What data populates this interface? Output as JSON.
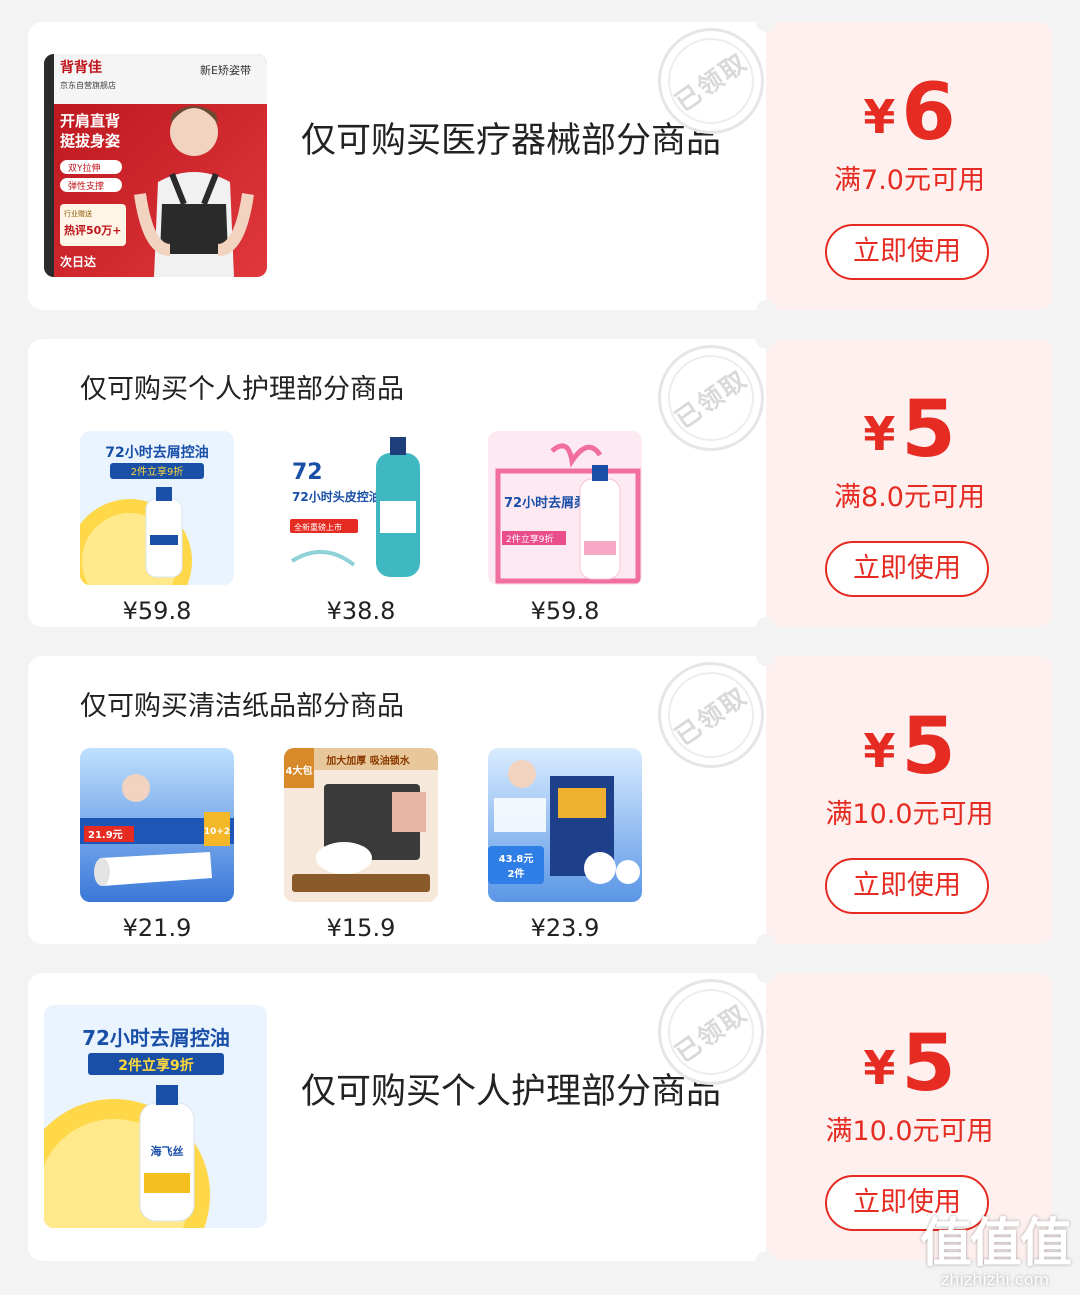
{
  "stamp_text": "已领取",
  "use_label": "立即使用",
  "currency": "¥",
  "coupons": [
    {
      "amount": "6",
      "condition": "满7.0元可用",
      "description": "仅可购买医疗器械部分商品",
      "thumb": {
        "brand": "背背佳",
        "store": "京东自营旗舰店",
        "tag": "新E矫姿带",
        "headline_1": "开肩直背",
        "headline_2": "挺拔身姿",
        "feature_1": "双Y拉伸",
        "feature_2": "弹性支撑",
        "badge_1": "行业赠送",
        "badge_2": "热评50万+",
        "delivery": "次日达"
      }
    },
    {
      "amount": "5",
      "condition": "满8.0元可用",
      "description": "仅可购买个人护理部分商品",
      "products": [
        {
          "price": "¥59.8",
          "headline": "72小时去屑控油",
          "promo": "2件立享9折",
          "icon": "shampoo-lemon"
        },
        {
          "price": "¥38.8",
          "headline": "72小时头皮控油",
          "promo": "全新重磅上市",
          "icon": "shampoo-teal"
        },
        {
          "price": "¥59.8",
          "headline": "72小时去屑柔顺",
          "promo": "2件立享9折",
          "icon": "shampoo-pink"
        }
      ]
    },
    {
      "amount": "5",
      "condition": "满10.0元可用",
      "description": "仅可购买清洁纸品部分商品",
      "products": [
        {
          "price": "¥21.9",
          "headline": "21.9元",
          "promo": "10+2",
          "icon": "tissue-roll"
        },
        {
          "price": "¥15.9",
          "headline": "加大加厚 吸油锁水",
          "promo": "4大包",
          "icon": "kitchen-paper"
        },
        {
          "price": "¥23.9",
          "headline": "43.8元",
          "promo": "2件",
          "icon": "toilet-paper"
        }
      ]
    },
    {
      "amount": "5",
      "condition": "满10.0元可用",
      "description": "仅可购买个人护理部分商品",
      "thumb": {
        "headline": "72小时去屑控油",
        "promo": "2件立享9折",
        "brand_cn": "海飞丝"
      }
    }
  ],
  "watermark": {
    "logo": "值值值",
    "url": "zhizhizhi.com"
  },
  "colors": {
    "accent": "#e52b22",
    "coupon_bg": "#fdf0ef",
    "page_bg": "#f3f3f3"
  }
}
